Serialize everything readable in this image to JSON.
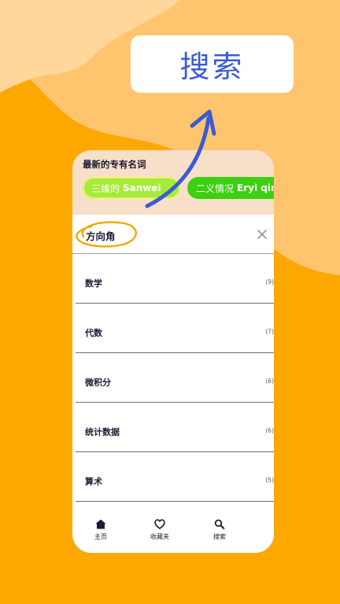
{
  "banner": {
    "title": "搜索"
  },
  "recent": {
    "title": "最新的专有名词",
    "chips": [
      {
        "zh": "三维的",
        "pinyin": "Sanwei"
      },
      {
        "zh": "二义情况",
        "pinyin": "Eryi qin"
      }
    ]
  },
  "search": {
    "query": "方向角"
  },
  "categories": [
    {
      "name": "数学",
      "count": "(9)"
    },
    {
      "name": "代数",
      "count": "(7)"
    },
    {
      "name": "微积分",
      "count": "(6)"
    },
    {
      "name": "统计数据",
      "count": "(6)"
    },
    {
      "name": "算术",
      "count": "(5)"
    }
  ],
  "nav": {
    "home": {
      "label": "主页",
      "icon": "home-icon"
    },
    "favorites": {
      "label": "收藏夹",
      "icon": "heart-icon"
    },
    "search": {
      "label": "搜索",
      "icon": "search-icon"
    }
  },
  "colors": {
    "background": "#FDA800",
    "wave": "#FFC56E",
    "accent_blue": "#3a5bd3",
    "chip_light_green": "#A6EA3A",
    "chip_green": "#3CD010",
    "highlight_circle": "#F2A900"
  }
}
